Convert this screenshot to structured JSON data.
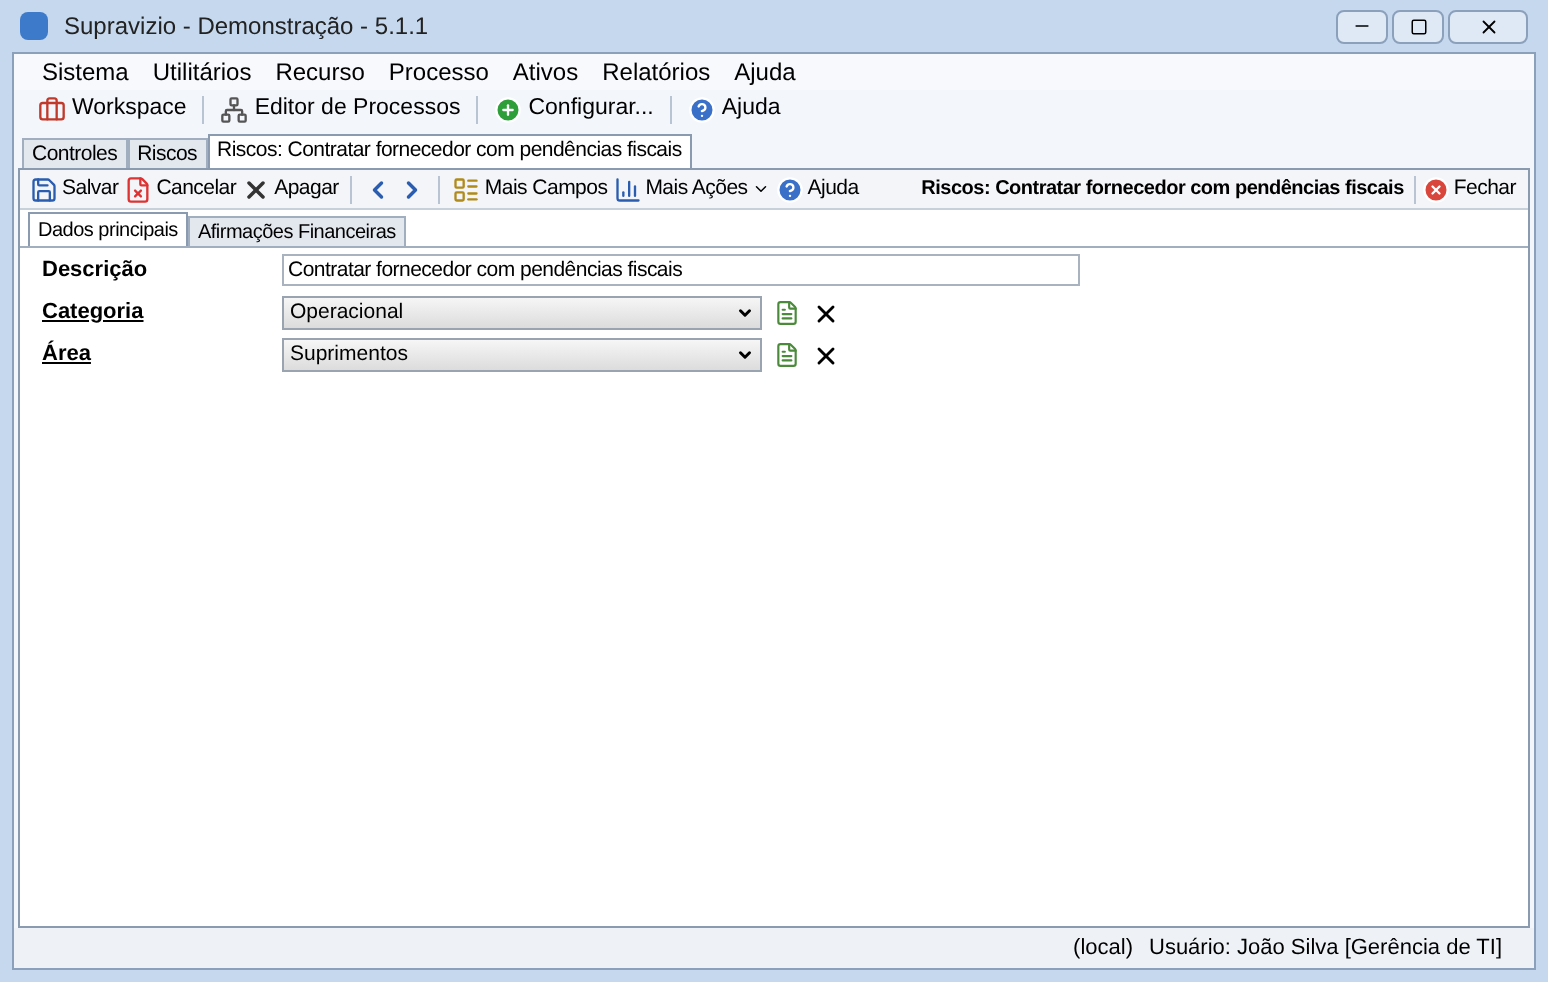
{
  "window": {
    "title": "Supravizio - Demonstração - 5.1.1"
  },
  "menu": [
    "Sistema",
    "Utilitários",
    "Recurso",
    "Processo",
    "Ativos",
    "Relatórios",
    "Ajuda"
  ],
  "toolbar": [
    {
      "kind": "workspace",
      "label": "Workspace"
    },
    {
      "kind": "process",
      "label": "Editor de Processos"
    },
    {
      "kind": "config",
      "label": "Configurar..."
    },
    {
      "kind": "help",
      "label": "Ajuda"
    }
  ],
  "doc_tabs": [
    {
      "label": "Controles",
      "selected": false
    },
    {
      "label": "Riscos",
      "selected": false
    },
    {
      "label": "Riscos: Contratar fornecedor com pendências fiscais",
      "selected": true
    }
  ],
  "actions": [
    {
      "kind": "save",
      "label": "Salvar"
    },
    {
      "kind": "cancel",
      "label": "Cancelar"
    },
    {
      "kind": "delete",
      "label": "Apagar"
    },
    {
      "kind": "separator"
    },
    {
      "kind": "prev"
    },
    {
      "kind": "next"
    },
    {
      "kind": "separator"
    },
    {
      "kind": "fields",
      "label": "Mais Campos"
    },
    {
      "kind": "more",
      "label": "Mais Ações"
    },
    {
      "kind": "help",
      "label": "Ajuda"
    }
  ],
  "record_title": "Riscos: Contratar fornecedor com pendências fiscais",
  "close_label": "Fechar",
  "form_tabs": [
    {
      "label": "Dados principais",
      "selected": true
    },
    {
      "label": "Afirmações Financeiras",
      "selected": false
    }
  ],
  "fields": [
    {
      "kind": "text",
      "label": "Descrição",
      "value": "Contratar fornecedor com pendências fiscais"
    },
    {
      "kind": "select",
      "label": "Categoria",
      "value": "Operacional"
    },
    {
      "kind": "select",
      "label": "Área",
      "value": "Suprimentos"
    }
  ],
  "status_bar": {
    "server": "(local)",
    "user": "Usuário: João Silva [Gerência de TI]"
  }
}
